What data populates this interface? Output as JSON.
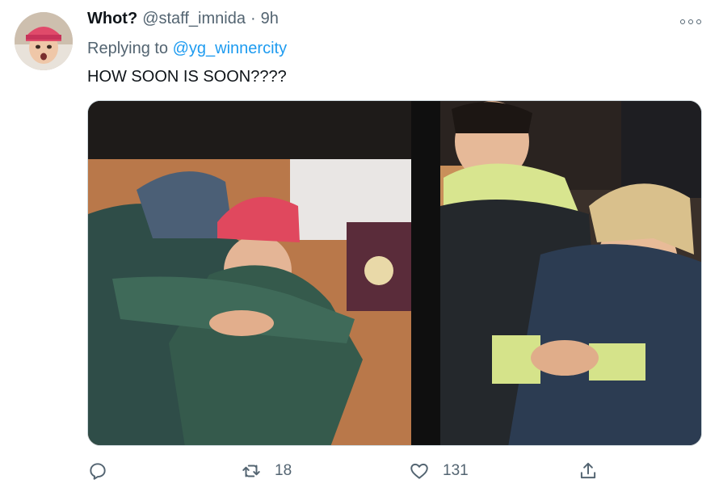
{
  "tweet": {
    "display_name": "Whot?",
    "handle": "@staff_imnida",
    "separator": "·",
    "time": "9h",
    "replying_prefix": "Replying to",
    "replying_to": "@yg_winnercity",
    "text": "HOW SOON IS SOON????"
  },
  "actions": {
    "reply_count": "",
    "retweet_count": "18",
    "like_count": "131"
  },
  "icons": {
    "avatar": "avatar-image",
    "more": "more-options-icon",
    "reply": "reply-icon",
    "retweet": "retweet-icon",
    "like": "heart-icon",
    "share": "share-icon"
  },
  "colors": {
    "text_primary": "#0f1419",
    "text_secondary": "#536471",
    "link": "#1d9bf0",
    "border": "#cfd9de"
  }
}
